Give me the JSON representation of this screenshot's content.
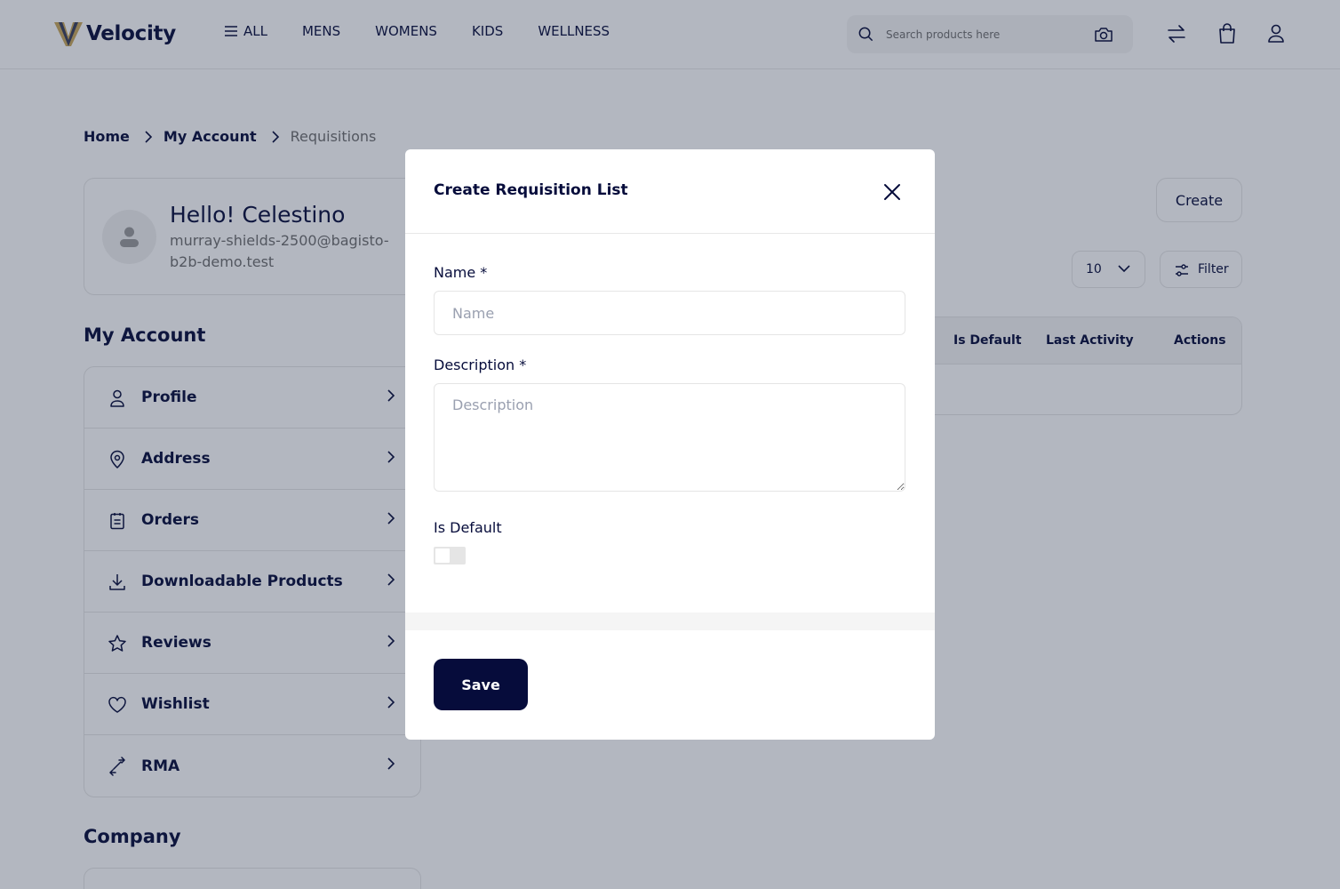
{
  "header": {
    "logo_text": "Velocity",
    "nav": [
      {
        "label": "ALL"
      },
      {
        "label": "MENS"
      },
      {
        "label": "WOMENS"
      },
      {
        "label": "KIDS"
      },
      {
        "label": "WELLNESS"
      }
    ],
    "search_placeholder": "Search products here"
  },
  "breadcrumb": {
    "home": "Home",
    "account": "My Account",
    "current": "Requisitions"
  },
  "profile": {
    "greeting": "Hello! Celestino",
    "email": "murray-shields-2500@bagisto-b2b-demo.test"
  },
  "sidebar": {
    "title": "My Account",
    "items": [
      {
        "label": "Profile",
        "icon": "user-icon"
      },
      {
        "label": "Address",
        "icon": "location-pin-icon"
      },
      {
        "label": "Orders",
        "icon": "clipboard-icon"
      },
      {
        "label": "Downloadable Products",
        "icon": "download-icon"
      },
      {
        "label": "Reviews",
        "icon": "star-icon"
      },
      {
        "label": "Wishlist",
        "icon": "heart-icon"
      },
      {
        "label": "RMA",
        "icon": "swap-arrows-icon"
      }
    ],
    "company_title": "Company"
  },
  "main": {
    "create_label": "Create",
    "per_page": "10",
    "filter_label": "Filter",
    "columns": [
      "Is Default",
      "Last Activity",
      "Actions"
    ]
  },
  "modal": {
    "title": "Create Requisition List",
    "name_label": "Name *",
    "name_placeholder": "Name",
    "description_label": "Description *",
    "description_placeholder": "Description",
    "default_label": "Is Default",
    "is_default": false,
    "save_label": "Save"
  },
  "colors": {
    "brand_navy": "#060C3B",
    "logo_gold": "#C9A75A",
    "overlay": "rgba(33,45,71,0.34)"
  }
}
